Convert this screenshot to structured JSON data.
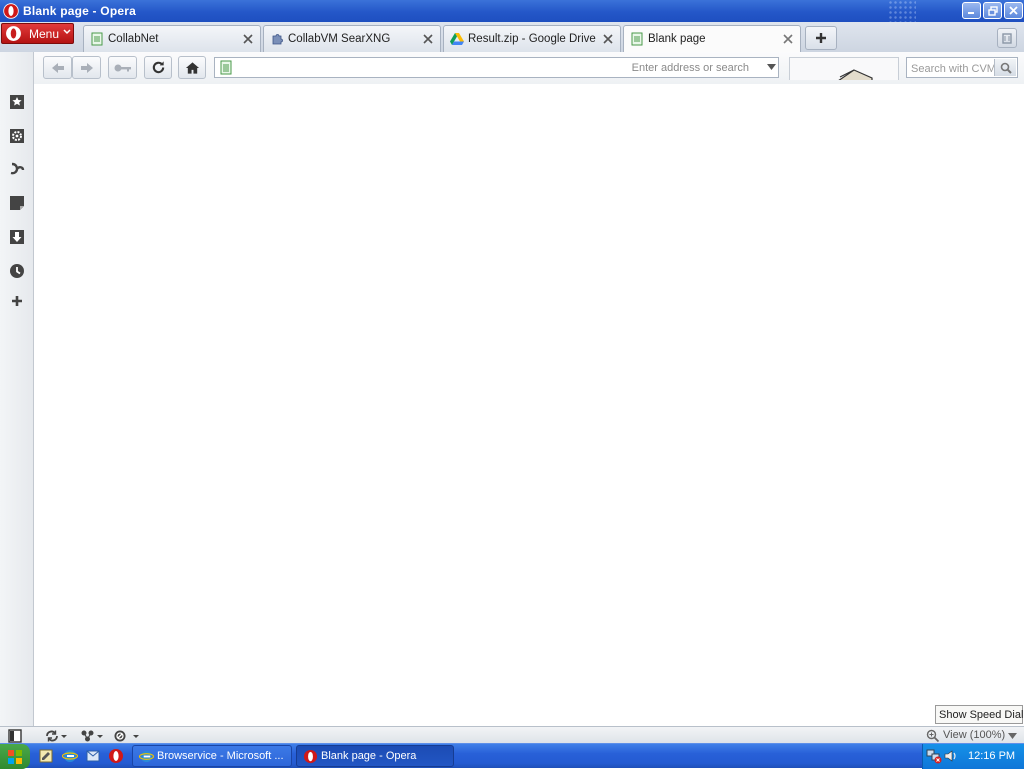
{
  "window": {
    "title": "Blank page - Opera"
  },
  "menu": {
    "label": "Menu"
  },
  "tabs": [
    {
      "label": "CollabNet",
      "icon": "page-icon",
      "active": false
    },
    {
      "label": "CollabVM SearXNG",
      "icon": "puzzle-icon",
      "active": false
    },
    {
      "label": "Result.zip - Google Drive",
      "icon": "google-drive-icon",
      "active": false
    },
    {
      "label": "Blank page",
      "icon": "page-icon",
      "active": true
    }
  ],
  "toolbar": {
    "address_value": "",
    "address_placeholder": "Enter address or search",
    "search_placeholder": "Search with CVM"
  },
  "sidepanel": {
    "items": [
      "bookmarks-icon",
      "settings-gear-icon",
      "widgets-icon",
      "notes-icon",
      "downloads-icon",
      "history-icon",
      "add-panel-icon"
    ]
  },
  "statusbar": {
    "zoom": "View (100%)",
    "tooltip": "Show Speed Dial"
  },
  "taskbar": {
    "buttons": [
      {
        "label": "Browservice - Microsoft ...",
        "icon": "internet-explorer-icon",
        "active": false
      },
      {
        "label": "Blank page - Opera",
        "icon": "opera-icon",
        "active": true
      }
    ],
    "clock": "12:16 PM"
  },
  "colors": {
    "titlebar": "#2457c8",
    "menu_button": "#c81e1e",
    "taskbar": "#245bd2",
    "tray": "#0f76d8"
  }
}
